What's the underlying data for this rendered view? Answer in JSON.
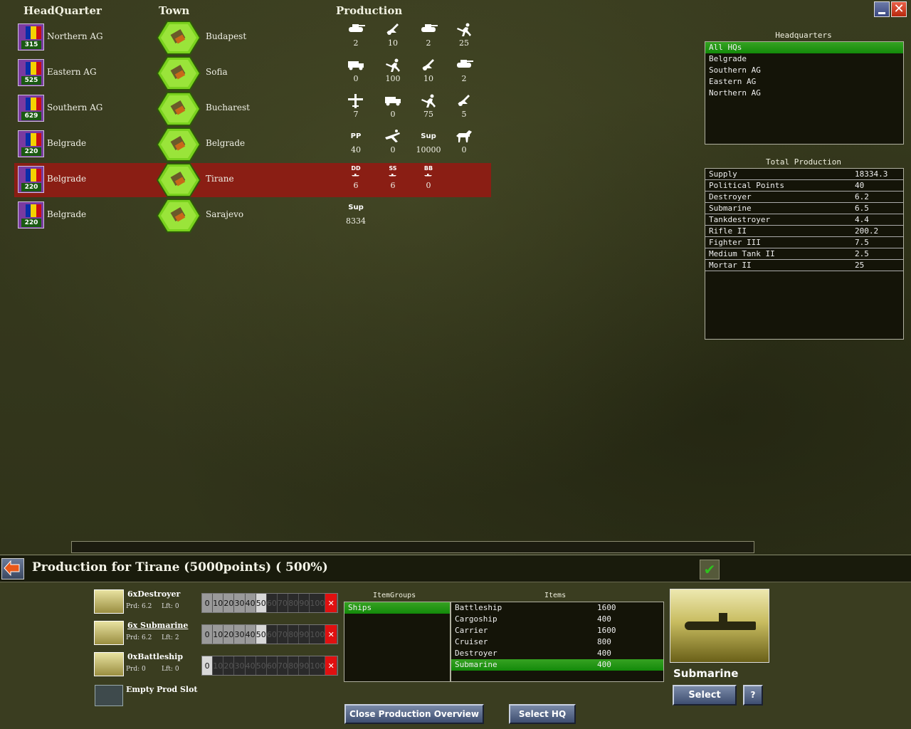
{
  "columns": {
    "hq": "HeadQuarter",
    "town": "Town",
    "production": "Production"
  },
  "rows": [
    {
      "hq_num": "315",
      "hq_name": "Northern AG",
      "town": "Budapest",
      "items": [
        {
          "icon": "tank-icon",
          "value": "2"
        },
        {
          "icon": "artillery-icon",
          "value": "10"
        },
        {
          "icon": "tank-icon",
          "value": "2"
        },
        {
          "icon": "infantry-icon",
          "value": "25"
        }
      ]
    },
    {
      "hq_num": "525",
      "hq_name": "Eastern AG",
      "town": "Sofia",
      "items": [
        {
          "icon": "truck-icon",
          "value": "0"
        },
        {
          "icon": "infantry-icon",
          "value": "100"
        },
        {
          "icon": "artillery-icon",
          "value": "10"
        },
        {
          "icon": "tank-icon",
          "value": "2"
        }
      ]
    },
    {
      "hq_num": "629",
      "hq_name": "Southern AG",
      "town": "Bucharest",
      "items": [
        {
          "icon": "plane-icon",
          "value": "7"
        },
        {
          "icon": "truck-icon",
          "value": "0"
        },
        {
          "icon": "infantry-icon",
          "value": "75"
        },
        {
          "icon": "artillery-icon",
          "value": "5"
        }
      ]
    },
    {
      "hq_num": "220",
      "hq_name": "Belgrade",
      "town": "Belgrade",
      "items": [
        {
          "label": "PP",
          "value": "40"
        },
        {
          "icon": "paratrooper-icon",
          "value": "0"
        },
        {
          "label": "Sup",
          "value": "10000"
        },
        {
          "icon": "cavalry-icon",
          "value": "0"
        }
      ]
    },
    {
      "hq_num": "220",
      "hq_name": "Belgrade",
      "town": "Tirane",
      "selected": true,
      "items": [
        {
          "label": "DD",
          "icon": "ship-icon",
          "value": "6"
        },
        {
          "label": "SS",
          "icon": "ship-icon",
          "value": "6"
        },
        {
          "label": "BB",
          "icon": "ship-icon",
          "value": "0"
        }
      ]
    },
    {
      "hq_num": "220",
      "hq_name": "Belgrade",
      "town": "Sarajevo",
      "items": [
        {
          "label": "Sup",
          "value": "8334"
        }
      ]
    }
  ],
  "headquarters": {
    "title": "Headquarters",
    "items": [
      "All HQs",
      "Belgrade",
      "Southern AG",
      "Eastern AG",
      "Northern AG"
    ],
    "selected": 0
  },
  "total_production": {
    "title": "Total Production",
    "rows": [
      {
        "name": "Supply",
        "value": "18334.3"
      },
      {
        "name": "Political Points",
        "value": "40"
      },
      {
        "name": "Destroyer",
        "value": "6.2"
      },
      {
        "name": "Submarine",
        "value": "6.5"
      },
      {
        "name": "Tankdestroyer",
        "value": "4.4"
      },
      {
        "name": "Rifle II",
        "value": "200.2"
      },
      {
        "name": "Fighter III",
        "value": "7.5"
      },
      {
        "name": "Medium Tank II",
        "value": "2.5"
      },
      {
        "name": "Mortar II",
        "value": "25"
      }
    ]
  },
  "production_title": "Production for Tirane (5000points) ( 500%)",
  "slots": [
    {
      "name": "6xDestroyer",
      "prd": "Prd: 6.2",
      "lft": "Lft: 0",
      "percent": 50
    },
    {
      "name": "6x Submarine",
      "prd": "Prd: 6.2",
      "lft": "Lft: 2",
      "percent": 50
    },
    {
      "name": "0xBattleship",
      "prd": "Prd: 0",
      "lft": "Lft: 0",
      "percent": 0
    },
    {
      "name": "Empty Prod Slot"
    }
  ],
  "percent_steps": [
    "0",
    "10",
    "20",
    "30",
    "40",
    "50",
    "60",
    "70",
    "80",
    "90",
    "100"
  ],
  "item_groups": {
    "title": "ItemGroups",
    "items": [
      "Ships"
    ],
    "selected": 0
  },
  "items_list": {
    "title": "Items",
    "rows": [
      {
        "name": "Battleship",
        "cost": "1600"
      },
      {
        "name": "Cargoship",
        "cost": "400"
      },
      {
        "name": "Carrier",
        "cost": "1600"
      },
      {
        "name": "Cruiser",
        "cost": "800"
      },
      {
        "name": "Destroyer",
        "cost": "400"
      },
      {
        "name": "Submarine",
        "cost": "400"
      }
    ],
    "selected": 5
  },
  "selected_unit": "Submarine",
  "buttons": {
    "select": "Select",
    "help": "?",
    "close_overview": "Close Production Overview",
    "select_hq": "Select HQ",
    "remove": "✕",
    "ok": "✔",
    "minimize": "",
    "close": "✕"
  },
  "colors": {
    "selected_row": "#8a1e14",
    "list_highlight": "#1f9a14",
    "remove": "#e01010"
  }
}
